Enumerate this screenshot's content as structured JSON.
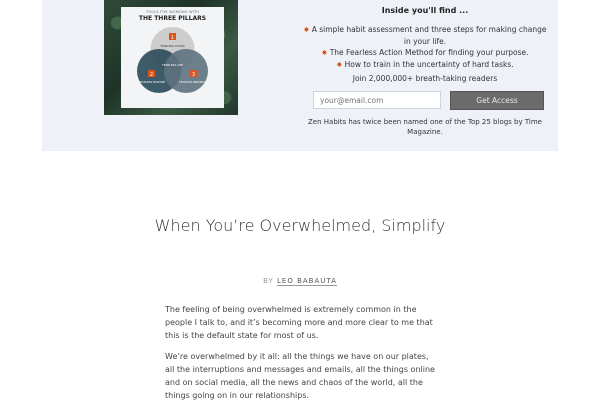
{
  "promo": {
    "book": {
      "card_subtitle": "TOOLS FOR WORKING WITH",
      "card_title": "THE THREE PILLARS",
      "circles": [
        "FEARLESS ACTION",
        "FEARLESS PURPOSE",
        "FEARLESS PRESENCE"
      ],
      "center": "FEARLESS LIFE",
      "numbers": [
        "1",
        "2",
        "3"
      ]
    },
    "inside_title": "Inside you'll find ...",
    "bullets": [
      "A simple habit assessment and three steps for making change in your life.",
      "The Fearless Action Method for finding your purpose.",
      "How to train in the uncertainty of hard tasks."
    ],
    "bullet_icon": "sparkle-icon",
    "readers": "Join 2,000,000+ breath-taking readers",
    "email_placeholder": "your@email.com",
    "button_label": "Get Access",
    "named": "Zen Habits has twice been named one of the Top 25 blogs by Time Magazine."
  },
  "article": {
    "title": "When You’re Overwhelmed, Simplify",
    "by": "BY",
    "author": "LEO BABAUTA",
    "paragraphs": [
      "The feeling of being overwhelmed is extremely common in the people I talk to, and it’s becoming more and more clear to me that this is the default state for most of us.",
      "We’re overwhelmed by it all: all the things we have on our plates, all the interruptions and messages and emails, all the things online and on social media, all the news and chaos of the world, all the things going on in our relationships."
    ]
  },
  "colors": {
    "promo_bg": "#eef2f8",
    "button_bg": "#6b6b6b",
    "accent_star": "#d9541e"
  }
}
